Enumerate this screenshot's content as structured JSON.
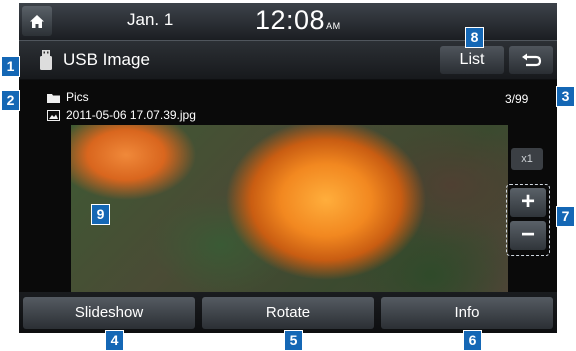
{
  "status_bar": {
    "date": "Jan.  1",
    "time": "12:08",
    "ampm": "AM"
  },
  "title_bar": {
    "title": "USB Image",
    "list_label": "List"
  },
  "content": {
    "folder_name": "Pics",
    "file_name": "2011-05-06 17.07.39.jpg",
    "counter": "3/99",
    "zoom_level": "x1",
    "zoom_in_label": "+",
    "zoom_out_label": "−"
  },
  "bottom_bar": {
    "buttons": [
      "Slideshow",
      "Rotate",
      "Info"
    ]
  },
  "callouts": [
    "1",
    "2",
    "3",
    "4",
    "5",
    "6",
    "7",
    "8",
    "9"
  ],
  "colors": {
    "callout_blue": "#1467b5",
    "flower_orange": "#f28820"
  },
  "icons": {
    "home": "home-icon",
    "usb": "usb-icon",
    "back": "back-arrow-icon",
    "folder": "folder-icon",
    "image_file": "image-file-icon"
  }
}
